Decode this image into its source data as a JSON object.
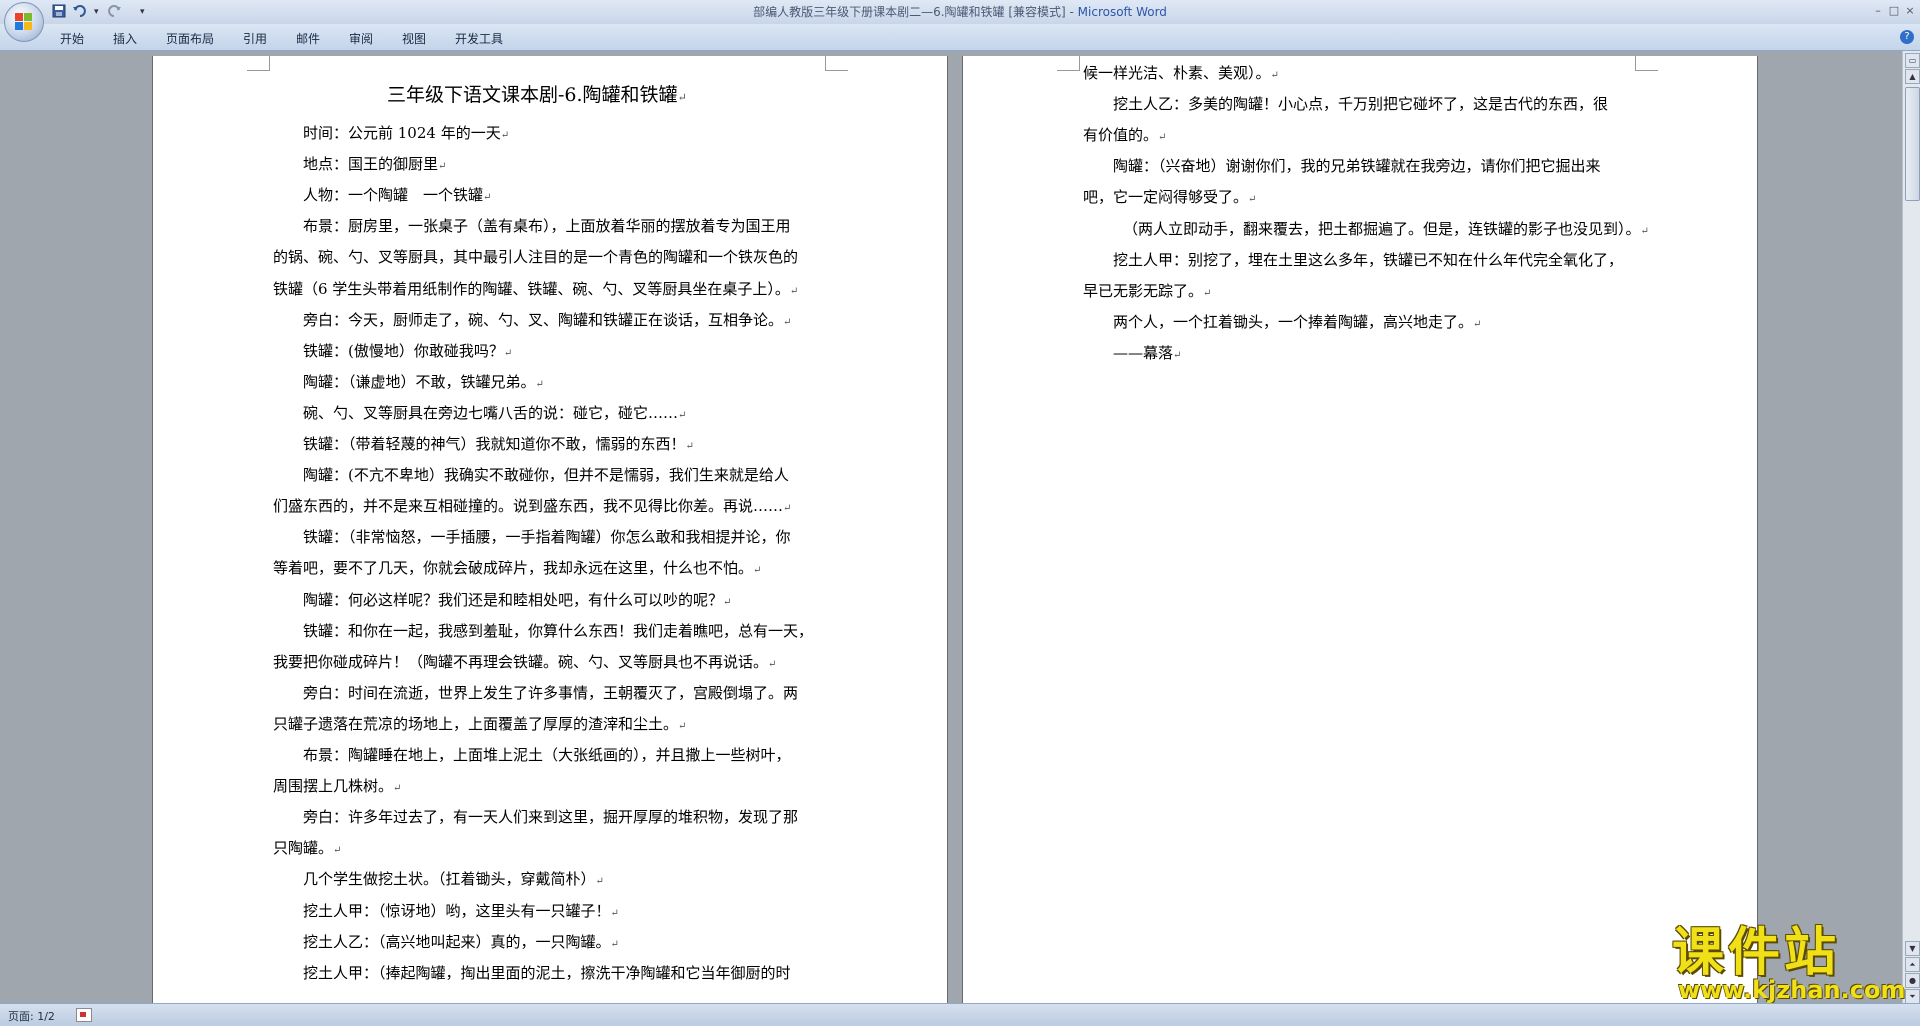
{
  "window": {
    "title": "部编人教版三年级下册课本剧二—6.陶罐和铁罐 [兼容模式] - ",
    "app_name": "Microsoft Word",
    "controls": [
      "–",
      "□",
      "×"
    ]
  },
  "quick_access": {
    "save_icon": "save-icon",
    "undo_icon": "undo-icon",
    "redo_icon": "redo-icon",
    "customize": "▾"
  },
  "ribbon": {
    "tabs": [
      {
        "label": "开始"
      },
      {
        "label": "插入"
      },
      {
        "label": "页面布局"
      },
      {
        "label": "引用"
      },
      {
        "label": "邮件"
      },
      {
        "label": "审阅"
      },
      {
        "label": "视图"
      },
      {
        "label": "开发工具"
      }
    ],
    "help": "?"
  },
  "document": {
    "title": "三年级下语文课本剧-6.陶罐和铁罐",
    "page1_lines": [
      "时间：公元前 1024 年的一天",
      "地点：国王的御厨里",
      "人物：一个陶罐　一个铁罐",
      "布景：厨房里，一张桌子（盖有桌布），上面放着华丽的摆放着专为国王用",
      "的锅、碗、勺、叉等厨具，其中最引人注目的是一个青色的陶罐和一个铁灰色的",
      "铁罐（6 学生头带着用纸制作的陶罐、铁罐、碗、勺、叉等厨具坐在桌子上）。",
      "旁白：今天，厨师走了，碗、勺、叉、陶罐和铁罐正在谈话，互相争论。",
      "铁罐：(傲慢地）你敢碰我吗？",
      "陶罐：（谦虚地）不敢，铁罐兄弟。",
      "碗、勺、叉等厨具在旁边七嘴八舌的说：碰它，碰它……",
      "铁罐：（带着轻蔑的神气）我就知道你不敢，懦弱的东西！",
      "陶罐：(不亢不卑地）我确实不敢碰你，但并不是懦弱，我们生来就是给人",
      "们盛东西的，并不是来互相碰撞的。说到盛东西，我不见得比你差。再说……",
      "铁罐：（非常恼怒，一手插腰，一手指着陶罐）你怎么敢和我相提并论，你",
      "等着吧，要不了几天，你就会破成碎片，我却永远在这里，什么也不怕。",
      "陶罐：何必这样呢？我们还是和睦相处吧，有什么可以吵的呢？",
      "铁罐：和你在一起，我感到羞耻，你算什么东西！我们走着瞧吧，总有一天，",
      "我要把你碰成碎片！（陶罐不再理会铁罐。碗、勺、叉等厨具也不再说话。",
      "旁白：时间在流逝，世界上发生了许多事情，王朝覆灭了，宫殿倒塌了。两",
      "只罐子遗落在荒凉的场地上，上面覆盖了厚厚的渣滓和尘土。",
      "布景：陶罐睡在地上，上面堆上泥土（大张纸画的），并且撒上一些树叶，",
      "周围摆上几株树。",
      "旁白：许多年过去了，有一天人们来到这里，掘开厚厚的堆积物，发现了那",
      "只陶罐。",
      "几个学生做挖土状。（扛着锄头，穿戴简朴）",
      "挖土人甲：（惊讶地）哟，这里头有一只罐子！",
      "挖土人乙：（高兴地叫起来）真的，一只陶罐。",
      "挖土人甲：（捧起陶罐，掏出里面的泥土，擦洗干净陶罐和它当年御厨的时"
    ],
    "page2_lines": [
      "候一样光洁、朴素、美观）。",
      "挖土人乙：多美的陶罐！小心点，千万别把它碰坏了，这是古代的东西，很",
      "有价值的。",
      "陶罐：（兴奋地）谢谢你们，我的兄弟铁罐就在我旁边，请你们把它掘出来",
      "吧，它一定闷得够受了。",
      "（两人立即动手，翻来覆去，把土都掘遍了。但是，连铁罐的影子也没见到）。",
      "挖土人甲：别挖了，埋在土里这么多年，铁罐已不知在什么年代完全氧化了，",
      "早已无影无踪了。",
      "两个人，一个扛着锄头，一个捧着陶罐，高兴地走了。",
      "——幕落"
    ],
    "paragraph_mark": "↵"
  },
  "status_bar": {
    "page_indicator": "页面: 1/2",
    "icon": "track-changes-icon"
  },
  "watermark": {
    "main": "课件站",
    "url": "www.kjzhan.com"
  }
}
